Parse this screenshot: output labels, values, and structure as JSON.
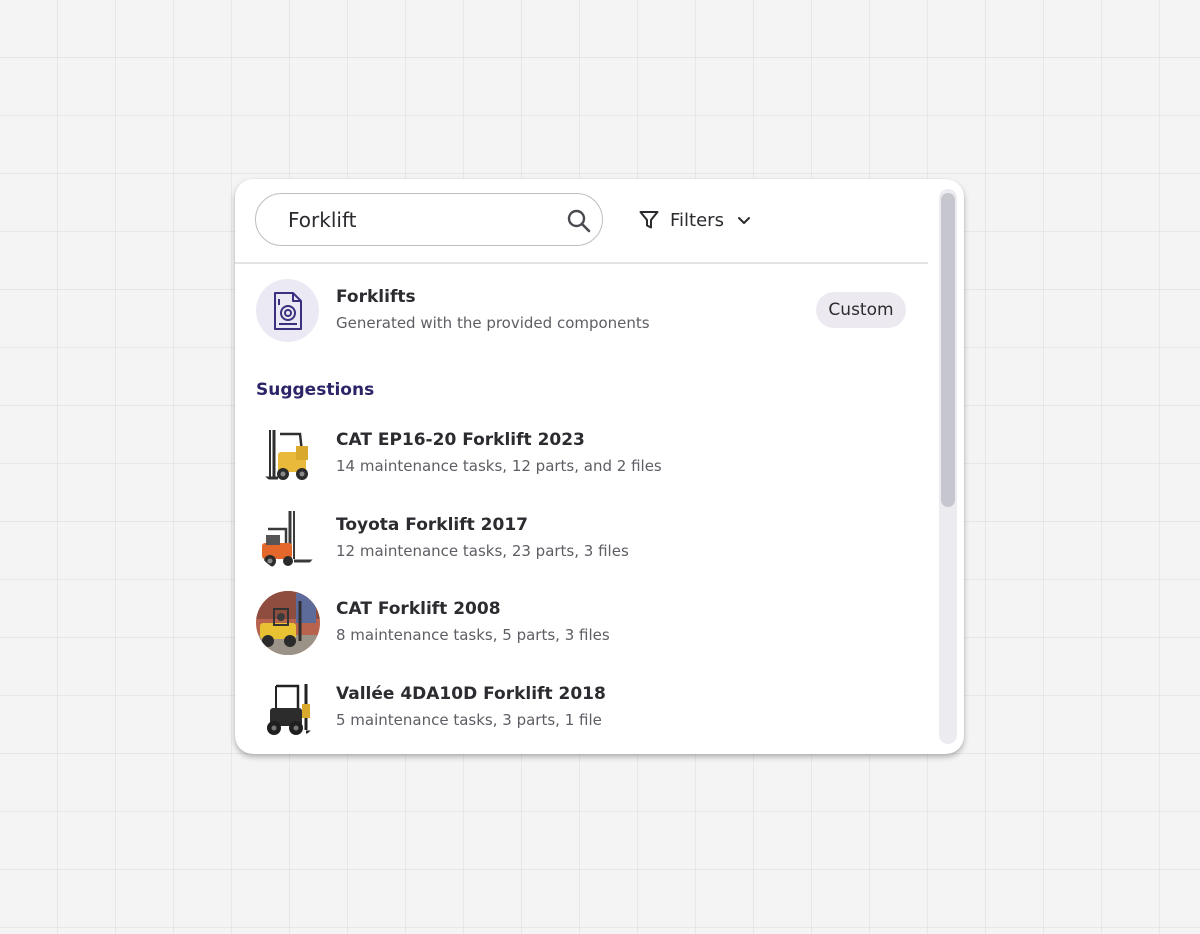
{
  "search": {
    "value": "Forklift",
    "icon": "search-icon"
  },
  "filters": {
    "label": "Filters",
    "icon": "filter-icon",
    "chevron_icon": "chevron-down-icon"
  },
  "result": {
    "icon": "document-icon",
    "title": "Forklifts",
    "subtitle": "Generated with the provided components",
    "badge": "Custom"
  },
  "suggestions": {
    "heading": "Suggestions",
    "items": [
      {
        "title": "CAT EP16-20 Forklift 2023",
        "subtitle": "14 maintenance tasks, 12 parts, and 2 files",
        "image": "forklift-photo"
      },
      {
        "title": "Toyota Forklift 2017",
        "subtitle": "12 maintenance tasks, 23 parts, 3 files",
        "image": "forklift-photo"
      },
      {
        "title": "CAT Forklift 2008",
        "subtitle": "8 maintenance tasks, 5 parts, 3 files",
        "image": "forklift-photo"
      },
      {
        "title": "Vallée 4DA10D Forklift 2018",
        "subtitle": "5 maintenance tasks, 3 parts, 1 file",
        "image": "forklift-photo"
      }
    ]
  },
  "colors": {
    "accent": "#2b2568",
    "background": "#f4f4f4",
    "panel": "#ffffff",
    "badge_bg": "#eceaf0"
  }
}
